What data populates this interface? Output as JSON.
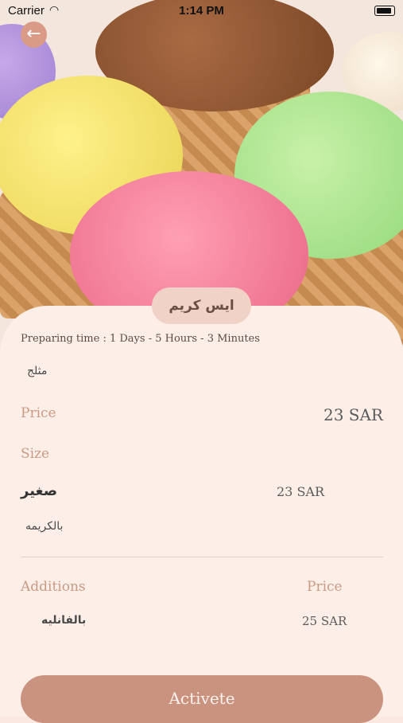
{
  "status_bar": {
    "carrier": "Carrier",
    "time": "1:14 PM"
  },
  "product": {
    "name": "ايس كريم",
    "preparing_time": "Preparing time : 1 Days - 5 Hours - 3 Minutes",
    "description": "مثلج",
    "price_label": "Price",
    "price_value": "23 SAR"
  },
  "size": {
    "label": "Size",
    "option_name": "صغير",
    "option_price": "23 SAR",
    "option_note": "بالكريمه"
  },
  "additions": {
    "label": "Additions",
    "price_header": "Price",
    "items": [
      {
        "name": "بالفانليه",
        "price": "25 SAR"
      }
    ]
  },
  "actions": {
    "activate_label": "Activete"
  },
  "colors": {
    "accent": "#c9937f",
    "card": "#fdefe8",
    "label": "#c99a84"
  }
}
